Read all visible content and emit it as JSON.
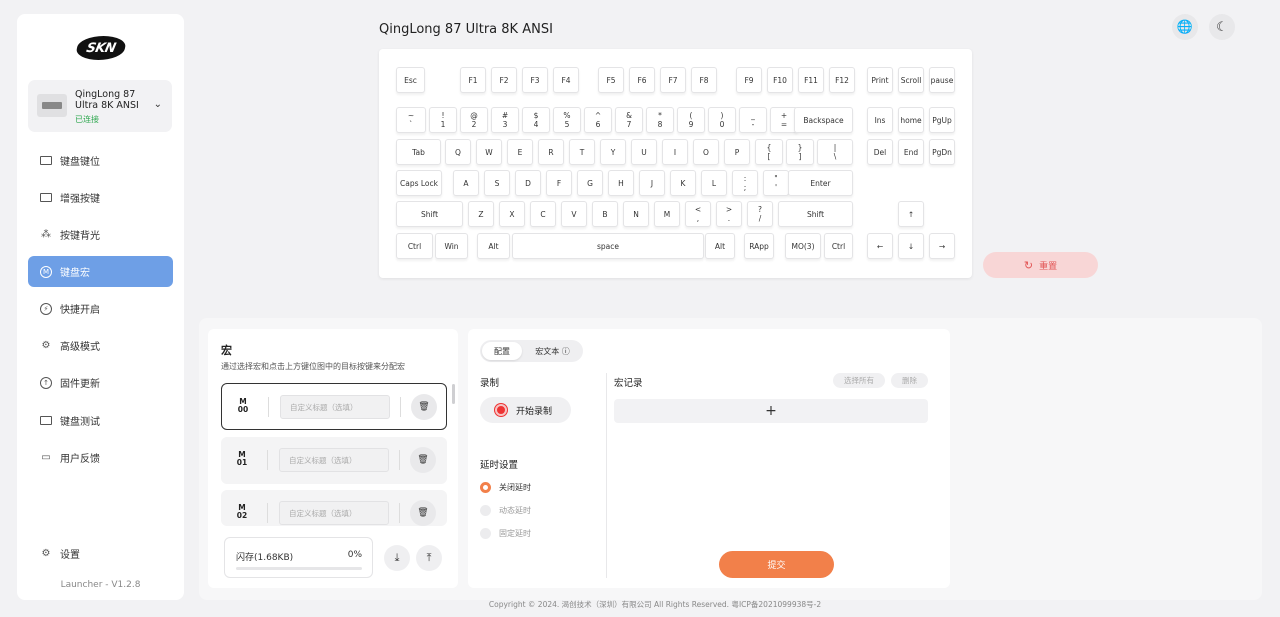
{
  "sidebar": {
    "logo": "SKN",
    "device": {
      "name": "QingLong 87 Ultra 8K ANSI",
      "status": "已连接"
    },
    "items": [
      {
        "label": "键盘键位",
        "icon": "keyboard-icon"
      },
      {
        "label": "增强按键",
        "icon": "enhanced-key-icon"
      },
      {
        "label": "按键背光",
        "icon": "backlight-icon"
      },
      {
        "label": "键盘宏",
        "icon": "macro-icon",
        "active": true
      },
      {
        "label": "快捷开启",
        "icon": "quick-start-icon"
      },
      {
        "label": "高级模式",
        "icon": "advanced-mode-icon"
      },
      {
        "label": "固件更新",
        "icon": "firmware-update-icon"
      },
      {
        "label": "键盘测试",
        "icon": "keyboard-test-icon"
      },
      {
        "label": "用户反馈",
        "icon": "feedback-icon"
      }
    ],
    "settings": "设置",
    "version": "Launcher - V1.2.8"
  },
  "header": {
    "title": "QingLong 87 Ultra 8K ANSI"
  },
  "reset_label": "重置",
  "keyboard_keys": [
    [
      "Esc"
    ],
    [
      "F1"
    ],
    [
      "F2"
    ],
    [
      "F3"
    ],
    [
      "F4"
    ],
    [
      "F5"
    ],
    [
      "F6"
    ],
    [
      "F7"
    ],
    [
      "F8"
    ],
    [
      "F9"
    ],
    [
      "F10"
    ],
    [
      "F11"
    ],
    [
      "F12"
    ],
    [
      "Print"
    ],
    [
      "Scroll"
    ],
    [
      "pause"
    ],
    [
      "~",
      "`"
    ],
    [
      "!",
      "1"
    ],
    [
      "@",
      "2"
    ],
    [
      "#",
      "3"
    ],
    [
      "$",
      "4"
    ],
    [
      "%",
      "5"
    ],
    [
      "^",
      "6"
    ],
    [
      "&",
      "7"
    ],
    [
      "*",
      "8"
    ],
    [
      "(",
      "9"
    ],
    [
      ")",
      "0"
    ],
    [
      "_",
      "-"
    ],
    [
      "+",
      "="
    ],
    [
      "Backspace"
    ],
    [
      "Ins"
    ],
    [
      "home"
    ],
    [
      "PgUp"
    ],
    [
      "Tab"
    ],
    [
      "Q"
    ],
    [
      "W"
    ],
    [
      "E"
    ],
    [
      "R"
    ],
    [
      "T"
    ],
    [
      "Y"
    ],
    [
      "U"
    ],
    [
      "I"
    ],
    [
      "O"
    ],
    [
      "P"
    ],
    [
      "{",
      "["
    ],
    [
      "}",
      "]"
    ],
    [
      "|",
      "\\"
    ],
    [
      "Del"
    ],
    [
      "End"
    ],
    [
      "PgDn"
    ],
    [
      "Caps Lock"
    ],
    [
      "A"
    ],
    [
      "S"
    ],
    [
      "D"
    ],
    [
      "F"
    ],
    [
      "G"
    ],
    [
      "H"
    ],
    [
      "J"
    ],
    [
      "K"
    ],
    [
      "L"
    ],
    [
      ":",
      ";"
    ],
    [
      "\"",
      "'"
    ],
    [
      "Enter"
    ],
    [
      "Shift"
    ],
    [
      "Z"
    ],
    [
      "X"
    ],
    [
      "C"
    ],
    [
      "V"
    ],
    [
      "B"
    ],
    [
      "N"
    ],
    [
      "M"
    ],
    [
      "<",
      ","
    ],
    [
      ">",
      "."
    ],
    [
      "?",
      "/"
    ],
    [
      "Shift"
    ],
    [
      "↑"
    ],
    [
      "Ctrl"
    ],
    [
      "Win"
    ],
    [
      "Alt"
    ],
    [
      "space"
    ],
    [
      "Alt"
    ],
    [
      "RApp"
    ],
    [
      "MO(3)"
    ],
    [
      "Ctrl"
    ],
    [
      "←"
    ],
    [
      "↓"
    ],
    [
      "→"
    ]
  ],
  "macro": {
    "title": "宏",
    "description": "通过选择宏和点击上方键位图中的目标按键来分配宏",
    "slots": [
      {
        "badge_top": "M",
        "badge_bottom": "00",
        "placeholder": "自定义标题（选填）"
      },
      {
        "badge_top": "M",
        "badge_bottom": "01",
        "placeholder": "自定义标题（选填）"
      },
      {
        "badge_top": "M",
        "badge_bottom": "02",
        "placeholder": "自定义标题（选填）"
      }
    ],
    "storage_label": "闪存(1.68KB)",
    "storage_percent": "0%",
    "storage_fill": 0
  },
  "config": {
    "tabs": [
      "配置",
      "宏文本 ⓘ"
    ],
    "record_label": "录制",
    "start_record": "开始录制",
    "delay_label": "延时设置",
    "delay_options": [
      "关闭延时",
      "动态延时",
      "固定延时"
    ],
    "macro_record_label": "宏记录",
    "select_all": "选择所有",
    "delete": "删除",
    "submit": "提交"
  },
  "footer": "Copyright © 2024. 渴创技术（深圳）有限公司 All Rights Reserved. 粤ICP备2021099938号-2"
}
